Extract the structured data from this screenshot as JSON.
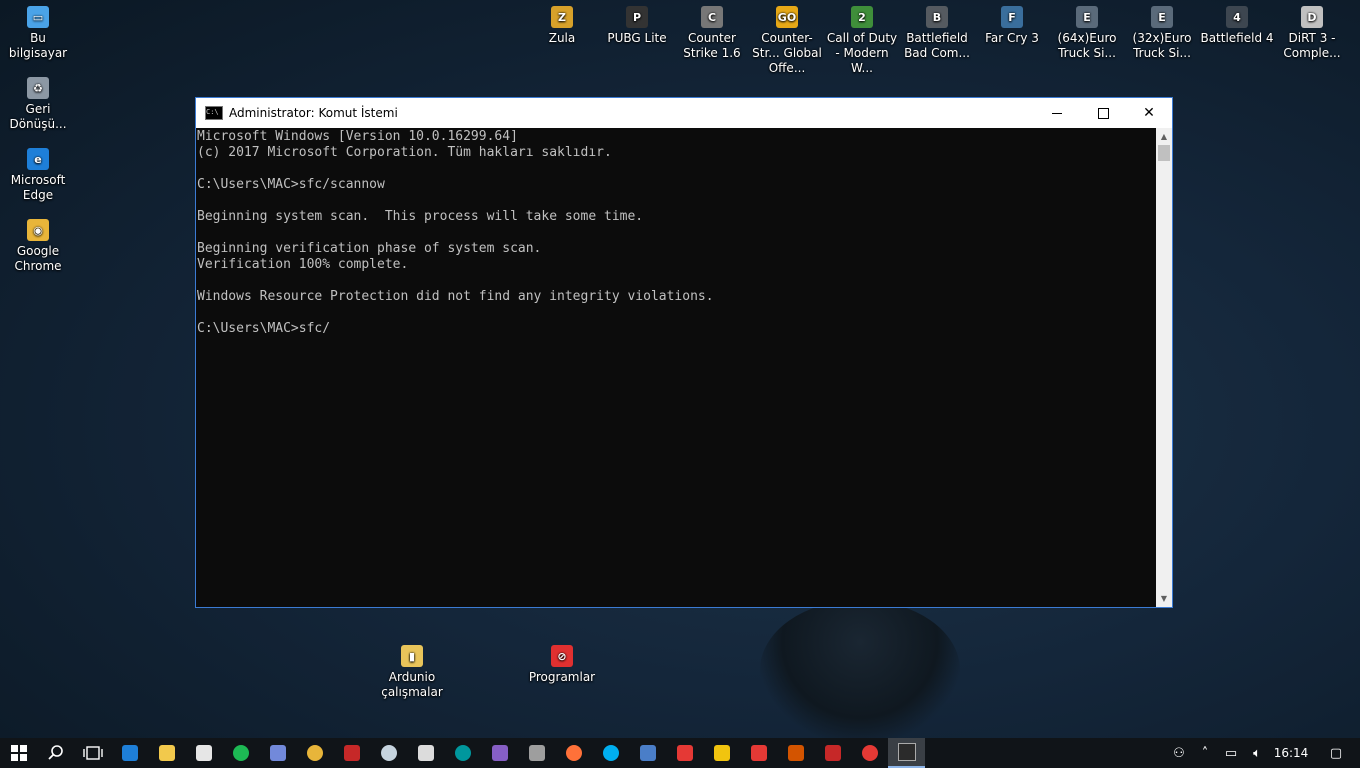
{
  "desktop": {
    "left_icons": [
      {
        "label": "Bu bilgisayar",
        "color": "#4aa3e8",
        "glyph": "▭"
      },
      {
        "label": "Geri Dönüşü...",
        "color": "#8c98a4",
        "glyph": "♻"
      },
      {
        "label": "Microsoft Edge",
        "color": "#1e7fd8",
        "glyph": "e"
      },
      {
        "label": "Google Chrome",
        "color": "#e8b53a",
        "glyph": "◉"
      }
    ],
    "top_icons": [
      {
        "label": "Zula",
        "color": "#d7a12a",
        "glyph": "Z"
      },
      {
        "label": "PUBG Lite",
        "color": "#333333",
        "glyph": "P"
      },
      {
        "label": "Counter Strike 1.6",
        "color": "#777777",
        "glyph": "C"
      },
      {
        "label": "Counter-Str... Global Offe...",
        "color": "#e6a817",
        "glyph": "GO"
      },
      {
        "label": "Call of Duty - Modern W...",
        "color": "#3f8e3a",
        "glyph": "2"
      },
      {
        "label": "Battlefield Bad Com...",
        "color": "#555a60",
        "glyph": "B"
      },
      {
        "label": "Far Cry 3",
        "color": "#3a6e9c",
        "glyph": "F"
      },
      {
        "label": "(64x)Euro Truck Si...",
        "color": "#5a6a7a",
        "glyph": "E"
      },
      {
        "label": "(32x)Euro Truck Si...",
        "color": "#5a6a7a",
        "glyph": "E"
      },
      {
        "label": "Battlefield 4",
        "color": "#3d4650",
        "glyph": "4"
      },
      {
        "label": "DiRT 3 - Comple...",
        "color": "#c0c0c0",
        "glyph": "D"
      }
    ],
    "bottom_icons": [
      {
        "label": "Ardunio çalışmalar",
        "color": "#e8c45a",
        "glyph": "▮"
      },
      {
        "label": "Programlar",
        "color": "#e03030",
        "glyph": "⊘"
      }
    ]
  },
  "window": {
    "title": "Administrator: Komut İstemi",
    "icon_text": "C:\\",
    "console_lines": [
      "Microsoft Windows [Version 10.0.16299.64]",
      "(c) 2017 Microsoft Corporation. Tüm hakları saklıdır.",
      "",
      "C:\\Users\\MAC>sfc/scannow",
      "",
      "Beginning system scan.  This process will take some time.",
      "",
      "Beginning verification phase of system scan.",
      "Verification 100% complete.",
      "",
      "Windows Resource Protection did not find any integrity violations.",
      "",
      "C:\\Users\\MAC>sfc/"
    ],
    "close_glyph": "✕"
  },
  "taskbar": {
    "apps": [
      {
        "name": "edge",
        "color": "#1e7fd8"
      },
      {
        "name": "file-explorer",
        "color": "#f2c94c"
      },
      {
        "name": "store",
        "color": "#e6e6e6"
      },
      {
        "name": "spotify",
        "color": "#1db954"
      },
      {
        "name": "discord",
        "color": "#7289da"
      },
      {
        "name": "chrome",
        "color": "#e8b53a"
      },
      {
        "name": "msi-dragon",
        "color": "#c62828"
      },
      {
        "name": "steam",
        "color": "#c6d4df"
      },
      {
        "name": "plane-app",
        "color": "#dcdcdc"
      },
      {
        "name": "arduino",
        "color": "#00979d"
      },
      {
        "name": "visual-studio",
        "color": "#865fc5"
      },
      {
        "name": "media-app",
        "color": "#9e9e9e"
      },
      {
        "name": "firefox",
        "color": "#ff7139"
      },
      {
        "name": "skype",
        "color": "#00aff0"
      },
      {
        "name": "game-app",
        "color": "#4a7ec8"
      },
      {
        "name": "acrobat",
        "color": "#e53935"
      },
      {
        "name": "flash-app",
        "color": "#f1c40f"
      },
      {
        "name": "power-app",
        "color": "#e53935"
      },
      {
        "name": "game-launcher",
        "color": "#d35400"
      },
      {
        "name": "shield-app",
        "color": "#c62828"
      },
      {
        "name": "record-app",
        "color": "#e53935"
      },
      {
        "name": "command-prompt",
        "color": "#2b2b2b"
      }
    ],
    "clock": "16:14"
  }
}
